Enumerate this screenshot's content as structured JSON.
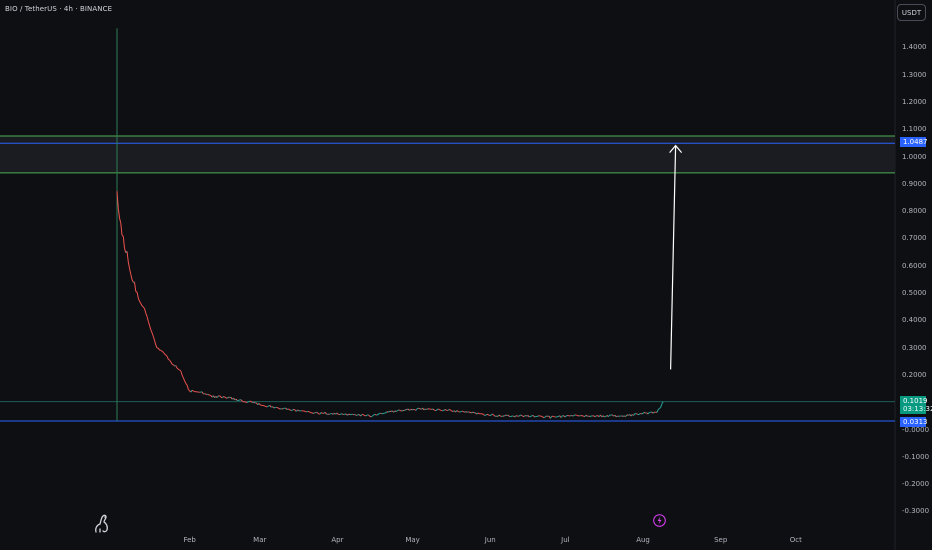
{
  "header": {
    "symbol_title": "BIO / TetherUS · 4h · BINANCE",
    "currency": "USDT"
  },
  "price_axis": {
    "labels": [
      {
        "text": "1.4000",
        "value": 1.4
      },
      {
        "text": "1.3000",
        "value": 1.3
      },
      {
        "text": "1.2000",
        "value": 1.2
      },
      {
        "text": "1.1000",
        "value": 1.1
      },
      {
        "text": "1.0000",
        "value": 1.0
      },
      {
        "text": "0.9000",
        "value": 0.9
      },
      {
        "text": "0.8000",
        "value": 0.8
      },
      {
        "text": "0.7000",
        "value": 0.7
      },
      {
        "text": "0.6000",
        "value": 0.6
      },
      {
        "text": "0.5000",
        "value": 0.5
      },
      {
        "text": "0.4000",
        "value": 0.4
      },
      {
        "text": "0.3000",
        "value": 0.3
      },
      {
        "text": "0.2000",
        "value": 0.2
      },
      {
        "text": "-0.0000",
        "value": 0.0
      },
      {
        "text": "-0.1000",
        "value": -0.1
      },
      {
        "text": "-0.2000",
        "value": -0.2
      },
      {
        "text": "-0.3000",
        "value": -0.3
      }
    ],
    "price_tags": {
      "resistance": "1.0487",
      "current": "0.1019",
      "countdown": "03:13:32",
      "support": "0.0313"
    }
  },
  "time_axis": {
    "labels": [
      "Feb",
      "Mar",
      "Apr",
      "May",
      "Jun",
      "Jul",
      "Aug",
      "Sep",
      "Oct"
    ]
  },
  "colors": {
    "background": "#0e0f13",
    "up": "#26a69a",
    "down": "#ef5350",
    "zone_line": "#4caf50",
    "blue_line": "#2962ff",
    "current_tag": "#089981",
    "arrow": "#ffffff"
  },
  "icons": {
    "logo": "tradingview-dino-icon",
    "event": "lightning-bolt-icon"
  },
  "chart_data": {
    "type": "line",
    "title": "",
    "timeframe": "4h",
    "y_range": [
      -0.33,
      1.48
    ],
    "x_range": [
      "2025-01-03",
      "2025-10-10"
    ],
    "resistance_zone": [
      0.94,
      1.075
    ],
    "horizontal_lines": [
      {
        "value": 1.0487,
        "color": "blue"
      },
      {
        "value": 0.1019,
        "color": "teal"
      },
      {
        "value": 0.0313,
        "color": "blue"
      }
    ],
    "vertical_line_date": "2025-01-03",
    "projection_arrow": {
      "from": [
        "2025-08-12",
        0.22
      ],
      "to": [
        "2025-08-14",
        1.04
      ]
    },
    "series": [
      {
        "x": [
          "2025-01-03",
          "2025-01-04",
          "2025-01-05",
          "2025-01-06",
          "2025-01-07",
          "2025-01-08",
          "2025-01-09",
          "2025-01-10",
          "2025-01-12",
          "2025-01-14",
          "2025-01-16",
          "2025-01-19",
          "2025-01-22",
          "2025-01-25",
          "2025-01-28",
          "2025-02-01",
          "2025-02-05",
          "2025-02-10",
          "2025-02-15",
          "2025-02-20",
          "2025-02-25",
          "2025-03-05",
          "2025-03-15",
          "2025-03-25",
          "2025-04-05",
          "2025-04-15",
          "2025-04-25",
          "2025-05-05",
          "2025-05-15",
          "2025-05-25",
          "2025-06-05",
          "2025-06-15",
          "2025-06-25",
          "2025-07-05",
          "2025-07-15",
          "2025-07-25",
          "2025-08-01",
          "2025-08-06",
          "2025-08-08",
          "2025-08-09"
        ],
        "values": [
          0.86,
          0.78,
          0.72,
          0.67,
          0.64,
          0.6,
          0.56,
          0.53,
          0.47,
          0.44,
          0.38,
          0.3,
          0.28,
          0.24,
          0.22,
          0.14,
          0.14,
          0.12,
          0.12,
          0.11,
          0.1,
          0.085,
          0.07,
          0.06,
          0.055,
          0.05,
          0.07,
          0.075,
          0.07,
          0.06,
          0.05,
          0.05,
          0.045,
          0.05,
          0.05,
          0.05,
          0.06,
          0.06,
          0.08,
          0.1019
        ]
      }
    ]
  }
}
